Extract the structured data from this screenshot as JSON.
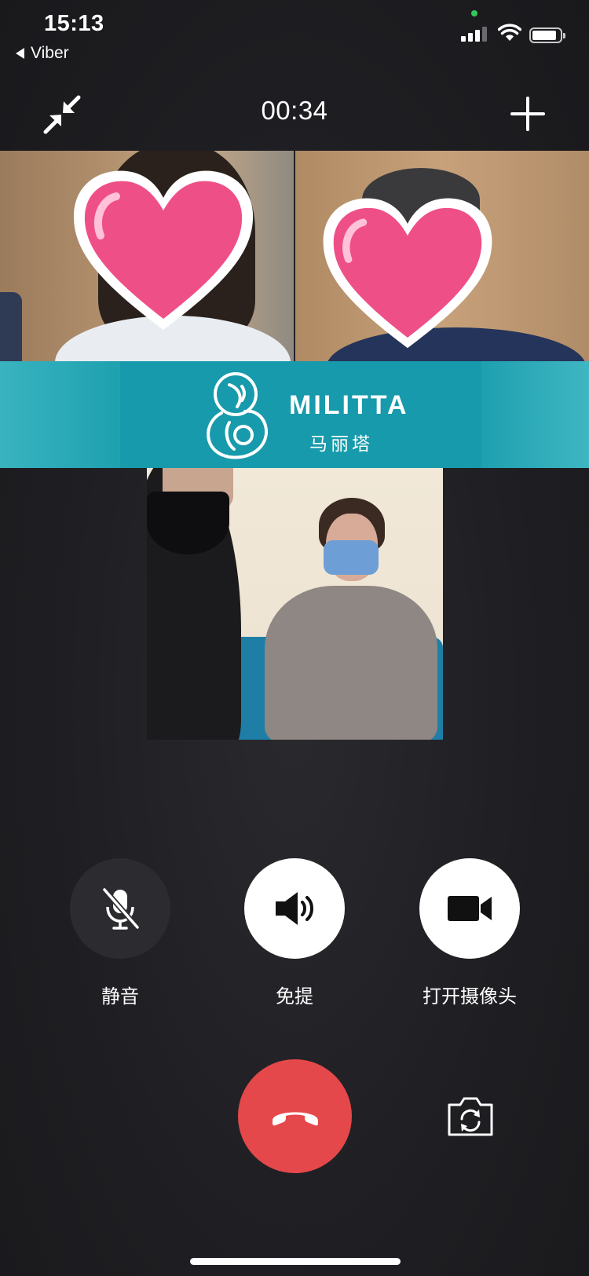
{
  "status_bar": {
    "time": "15:13",
    "back_app": "Viber",
    "signal_icon": "cellular-signal-icon",
    "wifi_icon": "wifi-icon",
    "battery_icon": "battery-icon"
  },
  "call": {
    "timer": "00:34",
    "minimize_icon": "collapse-arrows-icon",
    "add_icon": "plus-icon"
  },
  "banner": {
    "brand_name": "MILITTA",
    "brand_subtitle": "马丽塔",
    "logo_icon": "militta-logo-icon"
  },
  "controls": {
    "mute_label": "静音",
    "speaker_label": "免提",
    "camera_label": "打开摄像头",
    "mute_icon": "microphone-muted-icon",
    "speaker_icon": "speaker-icon",
    "camera_icon": "video-camera-icon",
    "end_call_icon": "hang-up-icon",
    "flip_camera_icon": "flip-camera-icon"
  },
  "colors": {
    "end_call": "#e5484b",
    "banner": "#179aab",
    "heart": "#f0578e"
  }
}
